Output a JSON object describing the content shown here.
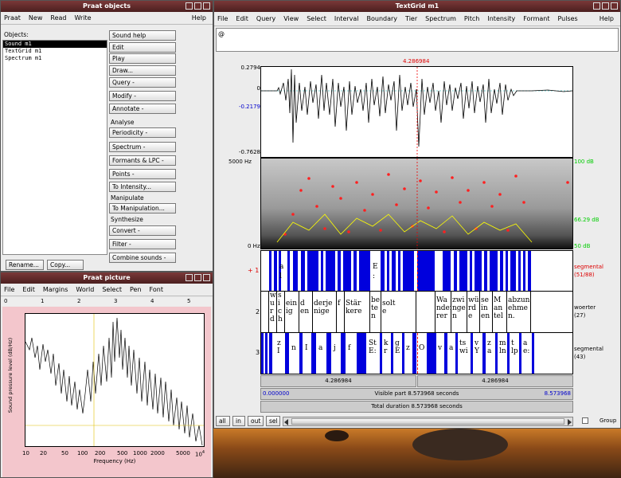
{
  "colors": {
    "accent": "#0000dd",
    "selection": "#ff0000",
    "titlebar": "#5a2424"
  },
  "objects": {
    "title": "Praat objects",
    "menu": [
      "Praat",
      "New",
      "Read",
      "Write"
    ],
    "help": "Help",
    "list_label": "Objects:",
    "items": [
      "Sound m1",
      "TextGrid m1",
      "Spectrum m1"
    ],
    "selected": "Sound m1",
    "rename": "Rename...",
    "copy": "Copy...",
    "buttons": [
      "Sound help",
      "Edit",
      "Play",
      "Draw...",
      "Query -",
      "Modify -",
      "Annotate -"
    ],
    "analyse_label": "Analyse",
    "analyse_buttons": [
      "Periodicity -",
      "Spectrum -",
      "Formants & LPC -",
      "Points -",
      "To Intensity..."
    ],
    "manipulate_label": "Manipulate",
    "manipulate_buttons": [
      "To Manipulation..."
    ],
    "synthesize_label": "Synthesize",
    "synthesize_buttons": [
      "Convert -",
      "Filter -",
      "Combine sounds -"
    ]
  },
  "picture": {
    "title": "Praat picture",
    "menu": [
      "File",
      "Edit",
      "Margins",
      "World",
      "Select",
      "Pen",
      "Font"
    ],
    "ruler": [
      "0",
      "1",
      "2",
      "3",
      "4",
      "5"
    ],
    "ylabel": "Sound pressure level (dB/Hz)",
    "xlabel": "Frequency (Hz)",
    "ticks": [
      "10",
      "20",
      "50",
      "100",
      "200",
      "500",
      "1000",
      "2000",
      "5000",
      "10"
    ],
    "tick_sup": "4"
  },
  "textgrid": {
    "title": "TextGrid m1",
    "menu": [
      "File",
      "Edit",
      "Query",
      "View",
      "Select",
      "Interval",
      "Boundary",
      "Tier",
      "Spectrum",
      "Pitch",
      "Intensity",
      "Formant",
      "Pulses"
    ],
    "help": "Help",
    "text_field": "@",
    "cursor_time": "4.286984",
    "wave_ticks": [
      "0.2794",
      "0",
      "-0.2179",
      "-0.7628"
    ],
    "spec_top": "5000 Hz",
    "spec_bottom": "0 Hz",
    "right_labels": [
      "100 dB",
      "66.29 dB",
      "50 dB"
    ],
    "tier1": {
      "num": "+ 1",
      "name": "segmental",
      "count": "(51/88)"
    },
    "tier2": {
      "num": "2",
      "name": "woerter",
      "count": "(27)"
    },
    "tier3": {
      "num": "3",
      "name": "segmental",
      "count": "(43)"
    },
    "tier1_labels": [
      "a",
      "l",
      "E",
      ":"
    ],
    "words": [
      [
        "w",
        "u",
        "r",
        "d"
      ],
      [
        "s",
        "i",
        "c",
        "h"
      ],
      [
        "ein",
        "ig"
      ],
      [
        "d",
        "en"
      ],
      [
        "derje",
        "nige"
      ],
      [
        "f"
      ],
      [
        "Stär",
        "kere"
      ],
      [
        "be",
        "te",
        "n"
      ],
      [
        "solt",
        "e"
      ],
      [
        "Wa",
        "nder",
        "rer"
      ],
      [
        "zwi",
        "nge",
        "n"
      ],
      [
        "wü",
        "rd",
        "e"
      ],
      [
        "se",
        "in",
        "en"
      ],
      [
        "M",
        "an",
        "tel"
      ],
      [
        "abzun",
        "ehme",
        "n."
      ]
    ],
    "segs": [
      [
        "z",
        "I"
      ],
      [
        "n"
      ],
      [
        "I"
      ],
      [
        "a"
      ],
      [
        "j"
      ],
      [
        "f"
      ],
      [
        "St",
        "E:"
      ],
      [
        "k",
        "r"
      ],
      [
        "g",
        "E"
      ],
      [
        "z"
      ],
      [
        "O"
      ],
      [
        "v"
      ],
      [
        "a"
      ],
      [
        "ts",
        "wi"
      ],
      [
        "v",
        "Y"
      ],
      [
        "z",
        "a"
      ],
      [
        "m",
        "ln"
      ],
      [
        "t",
        "lp"
      ],
      [
        "a",
        "e:"
      ]
    ],
    "bottom_time": "4.286984",
    "visible_left": "0.000000",
    "visible": "Visible part 8.573968 seconds",
    "visible_right": "8.573968",
    "total": "Total duration 8.573968 seconds",
    "nav": [
      "all",
      "in",
      "out",
      "sel"
    ],
    "group": "Group"
  }
}
